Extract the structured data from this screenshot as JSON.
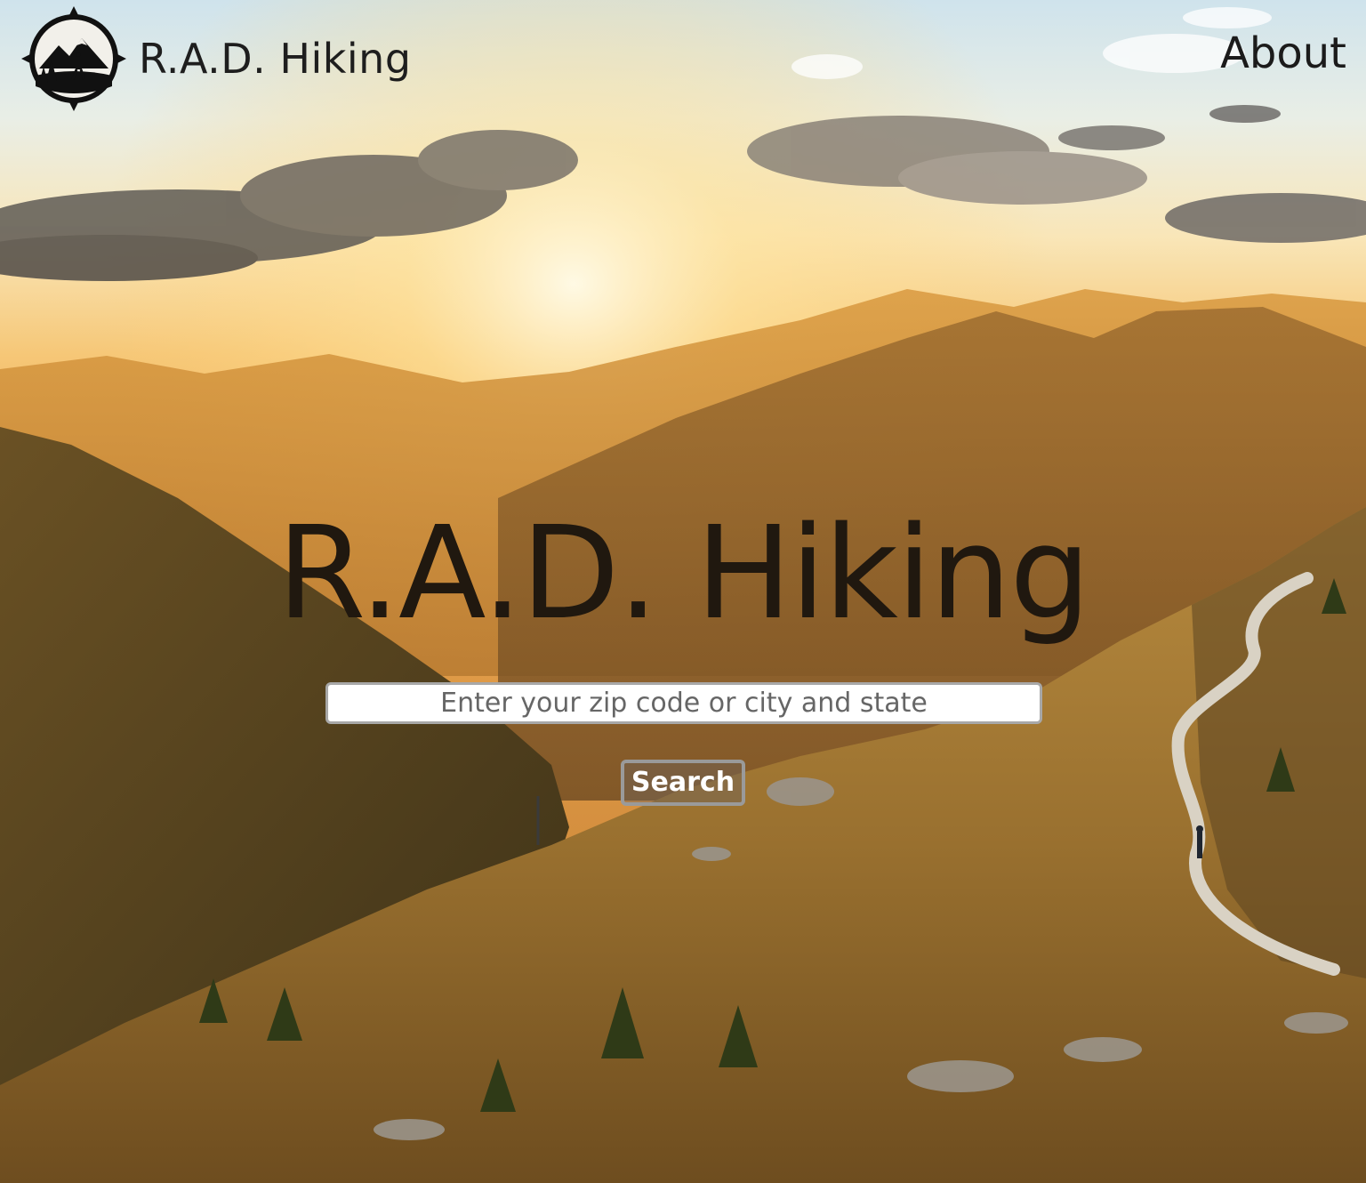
{
  "header": {
    "logo_icon": "compass-hiker-logo-icon",
    "brand_name": "R.A.D. Hiking",
    "nav_about": "About"
  },
  "hero": {
    "title": "R.A.D. Hiking",
    "background": "mountain-sunset-trail-photo"
  },
  "search": {
    "placeholder": "Enter your zip code or city and state",
    "value": "",
    "button_label": "Search"
  },
  "colors": {
    "title_text": "#20180f",
    "nav_text": "#1b1b1b",
    "button_text": "#ffffff",
    "input_border": "#a8a8a8"
  }
}
